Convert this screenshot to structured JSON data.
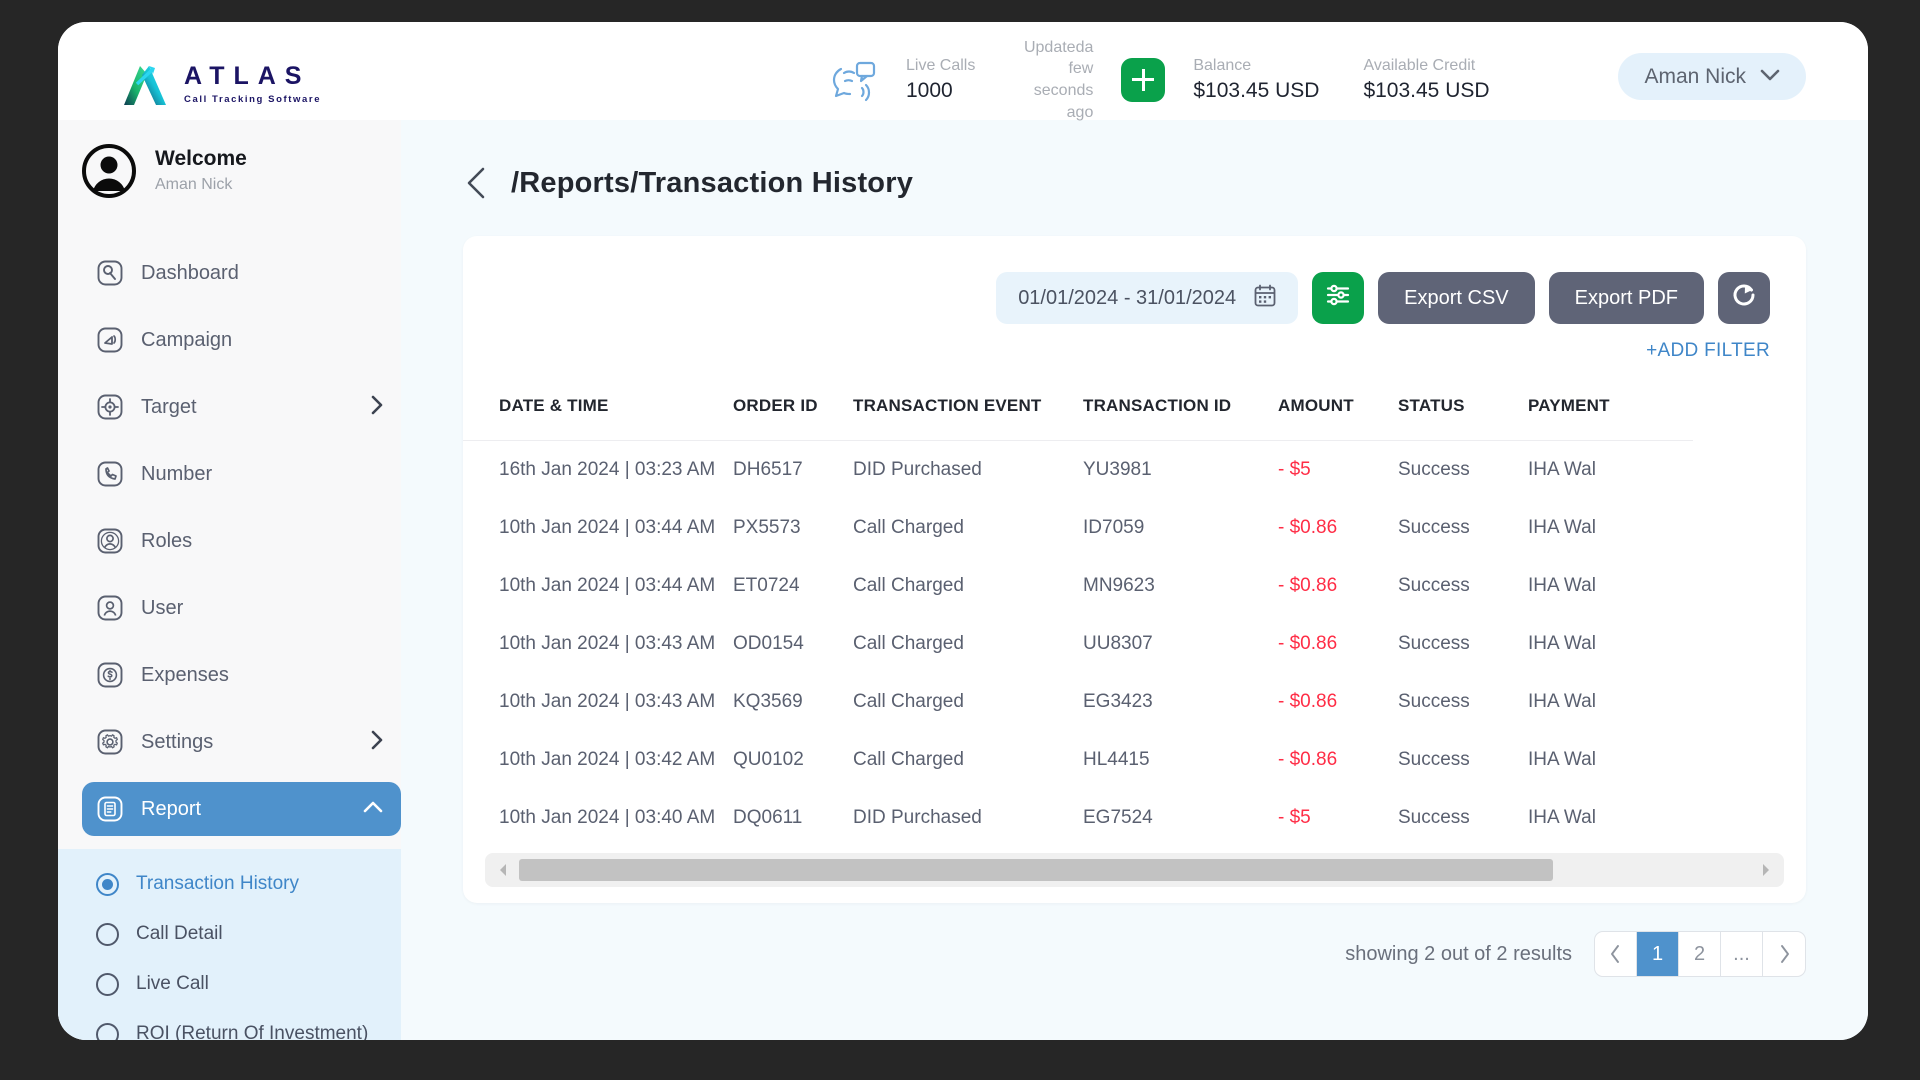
{
  "brand": {
    "name": "ATLAS",
    "tagline": "Call Tracking Software"
  },
  "header": {
    "stats": [
      {
        "label": "Live Calls",
        "value": "1000"
      },
      {
        "label": "Updateda few seconds ago",
        "value": ""
      },
      {
        "label": "Balance",
        "value": "$103.45 USD"
      },
      {
        "label": "Available Credit",
        "value": "$103.45 USD"
      }
    ],
    "live_calls_label": "Live Calls",
    "live_calls_value": "1000",
    "updated_line1": "Updateda few",
    "updated_line2": "seconds ago",
    "balance_label": "Balance",
    "balance_value": "$103.45 USD",
    "credit_label": "Available Credit",
    "credit_value": "$103.45 USD",
    "user_name": "Aman Nick",
    "add_icon": "plus-icon",
    "chevron_icon": "chevron-down-icon"
  },
  "sidebar": {
    "welcome_title": "Welcome",
    "welcome_name": "Aman Nick",
    "items": [
      {
        "label": "Dashboard",
        "icon": "dashboard-icon",
        "expandable": false
      },
      {
        "label": "Campaign",
        "icon": "campaign-icon",
        "expandable": false
      },
      {
        "label": "Target",
        "icon": "target-icon",
        "expandable": true
      },
      {
        "label": "Number",
        "icon": "phone-icon",
        "expandable": false
      },
      {
        "label": "Roles",
        "icon": "roles-icon",
        "expandable": false
      },
      {
        "label": "User",
        "icon": "user-icon",
        "expandable": false
      },
      {
        "label": "Expenses",
        "icon": "expenses-icon",
        "expandable": false
      },
      {
        "label": "Settings",
        "icon": "gear-icon",
        "expandable": true
      },
      {
        "label": "Report",
        "icon": "report-icon",
        "expandable": true,
        "active": true
      }
    ],
    "report_subitems": [
      {
        "label": "Transaction History",
        "selected": true
      },
      {
        "label": "Call Detail",
        "selected": false
      },
      {
        "label": "Live Call",
        "selected": false
      },
      {
        "label": "ROI (Return Of Investment)",
        "selected": false
      }
    ]
  },
  "main": {
    "breadcrumb": "/Reports/Transaction History",
    "back_icon": "chevron-left-icon",
    "toolbar": {
      "date_range": "01/01/2024 - 31/01/2024",
      "calendar_icon": "calendar-icon",
      "filter_icon": "sliders-icon",
      "export_csv": "Export CSV",
      "export_pdf": "Export PDF",
      "refresh_icon": "refresh-icon",
      "add_filter": "+ADD FILTER"
    },
    "table": {
      "columns": [
        "DATE & TIME",
        "ORDER ID",
        "TRANSACTION EVENT",
        "TRANSACTION ID",
        "AMOUNT",
        "STATUS",
        "PAYMENT"
      ],
      "rows": [
        {
          "datetime": "16th Jan 2024 | 03:23 AM",
          "order_id": "DH6517",
          "event": "DID Purchased",
          "transaction_id": "YU3981",
          "amount": "- $5",
          "status": "Success",
          "payment": "IHA Wal"
        },
        {
          "datetime": "10th Jan 2024 | 03:44 AM",
          "order_id": "PX5573",
          "event": "Call Charged",
          "transaction_id": "ID7059",
          "amount": "- $0.86",
          "status": "Success",
          "payment": "IHA Wal"
        },
        {
          "datetime": "10th Jan 2024 | 03:44 AM",
          "order_id": "ET0724",
          "event": "Call Charged",
          "transaction_id": "MN9623",
          "amount": "- $0.86",
          "status": "Success",
          "payment": "IHA Wal"
        },
        {
          "datetime": "10th Jan 2024 | 03:43 AM",
          "order_id": "OD0154",
          "event": "Call Charged",
          "transaction_id": "UU8307",
          "amount": "- $0.86",
          "status": "Success",
          "payment": "IHA Wal"
        },
        {
          "datetime": "10th Jan 2024 | 03:43 AM",
          "order_id": "KQ3569",
          "event": "Call Charged",
          "transaction_id": "EG3423",
          "amount": "- $0.86",
          "status": "Success",
          "payment": "IHA Wal"
        },
        {
          "datetime": "10th Jan 2024 | 03:42 AM",
          "order_id": "QU0102",
          "event": "Call Charged",
          "transaction_id": "HL4415",
          "amount": "- $0.86",
          "status": "Success",
          "payment": "IHA Wal"
        },
        {
          "datetime": "10th Jan 2024 | 03:40 AM",
          "order_id": "DQ0611",
          "event": "DID Purchased",
          "transaction_id": "EG7524",
          "amount": "- $5",
          "status": "Success",
          "payment": "IHA Wal"
        }
      ]
    },
    "footer": {
      "results_text": "showing 2 out of 2 results",
      "pages": [
        "1",
        "2",
        "..."
      ],
      "active_page": "1",
      "prev_icon": "chevron-left-icon",
      "next_icon": "chevron-right-icon"
    }
  },
  "colors": {
    "accent_blue": "#4f92cc",
    "sub_blue_bg": "#e2f1fb",
    "green": "#0aa14b",
    "slate": "#5f6477",
    "amount_red": "#ff2d46",
    "link_blue": "#3f86c8"
  }
}
